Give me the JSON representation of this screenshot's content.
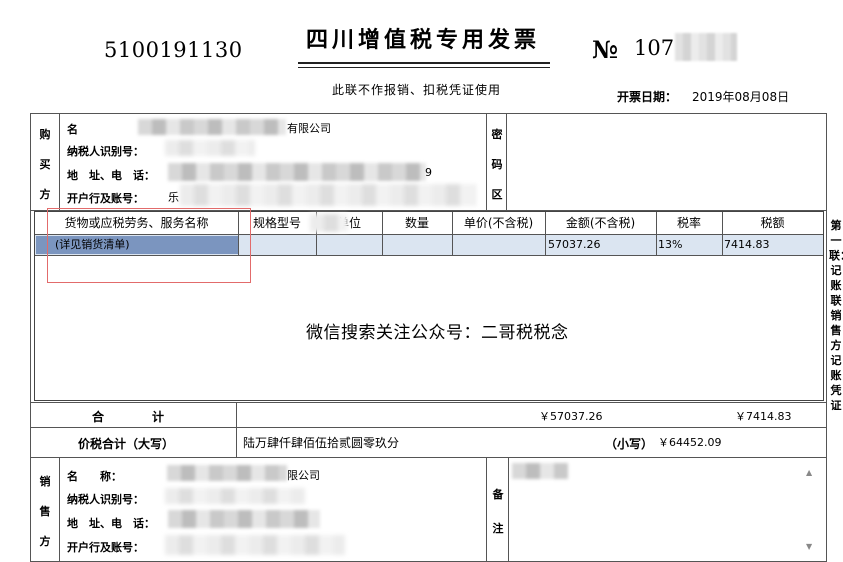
{
  "header": {
    "invoice_code": "5100191130",
    "title": "四川增值税专用发票",
    "number_sign": "№",
    "number_visible": "107",
    "subtitle": "此联不作报销、扣税凭证使用",
    "date_label": "开票日期：",
    "date_value": "2019年08月08日"
  },
  "buyer": {
    "side_label": [
      "购",
      "买",
      "方"
    ],
    "name_label": "名",
    "name_value": "有限公司",
    "tax_id_label": "纳税人识别号：",
    "address_label": "地　址、电　话：",
    "bank_label": "开户行及账号：",
    "address_tail": "9",
    "bank_head": "乐"
  },
  "cipher": {
    "side_label": [
      "密",
      "码",
      "区"
    ]
  },
  "goods_table": {
    "headers": [
      "货物或应税劳务、服务名称",
      "规格型号",
      "单位",
      "数量",
      "单价(不含税)",
      "金额(不含税)",
      "税率",
      "税额"
    ],
    "rows": [
      {
        "name": "(详见销货清单)",
        "spec": "",
        "unit": "",
        "qty": "",
        "price": "",
        "amount": "57037.26",
        "rate": "13%",
        "tax": "7414.83"
      }
    ],
    "watermark": "微信搜索关注公众号：二哥税税念"
  },
  "totals": {
    "sum_label": "合　　　　计",
    "amount_total": "￥57037.26",
    "tax_total": "￥7414.83",
    "grand_label": "价税合计（大写）",
    "grand_words": "陆万肆仟肆佰伍拾贰圆零玖分",
    "small_label": "（小写）",
    "grand_small": "￥64452.09"
  },
  "seller": {
    "side_label": [
      "销",
      "售",
      "方"
    ],
    "name_label": "名　　称：",
    "name_value": "限公司",
    "tax_id_label": "纳税人识别号：",
    "address_label": "地　址、电　话：",
    "bank_label": "开户行及账号："
  },
  "remarks": {
    "side_label": [
      "备",
      "注"
    ]
  },
  "copy_strip": "第一联：记账联　销售方记账凭证"
}
